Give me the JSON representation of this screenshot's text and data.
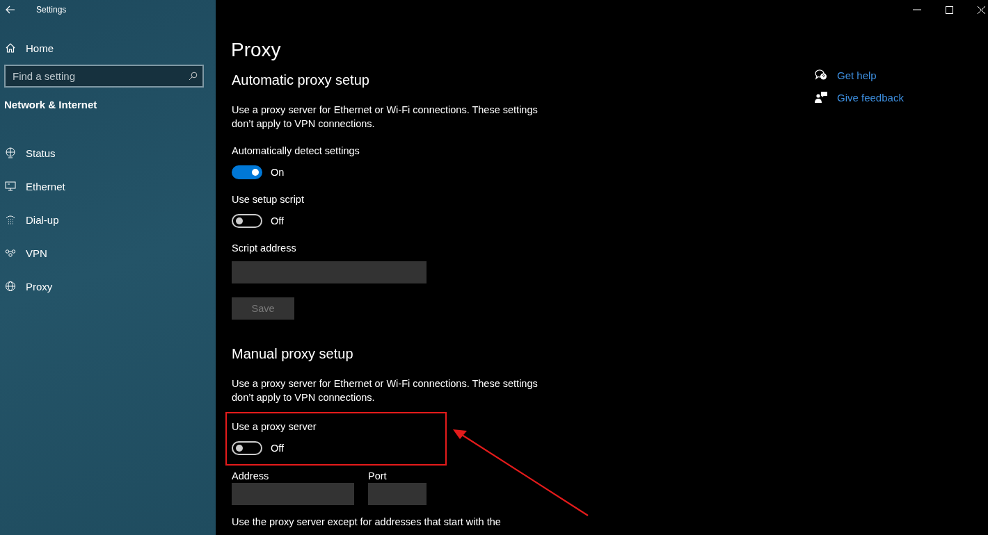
{
  "window": {
    "title": "Settings"
  },
  "sidebar": {
    "home": "Home",
    "search": {
      "placeholder": "Find a setting"
    },
    "section": "Network & Internet",
    "items": [
      {
        "label": "Status"
      },
      {
        "label": "Ethernet"
      },
      {
        "label": "Dial-up"
      },
      {
        "label": "VPN"
      },
      {
        "label": "Proxy"
      }
    ]
  },
  "page": {
    "title": "Proxy",
    "automatic": {
      "heading": "Automatic proxy setup",
      "description": "Use a proxy server for Ethernet or Wi-Fi connections. These settings don’t apply to VPN connections.",
      "toggles": [
        {
          "label": "Automatically detect settings",
          "on": true,
          "state": "On"
        },
        {
          "label": "Use setup script",
          "on": false,
          "state": "Off"
        }
      ],
      "script_address": {
        "label": "Script address"
      },
      "save": {
        "label": "Save",
        "disabled": true
      }
    },
    "manual": {
      "heading": "Manual proxy setup",
      "description": "Use a proxy server for Ethernet or Wi-Fi connections. These settings don’t apply to VPN connections.",
      "toggle": {
        "label": "Use a proxy server",
        "on": false,
        "state": "Off"
      },
      "address": {
        "label": "Address"
      },
      "port": {
        "label": "Port"
      },
      "exceptions_text": "Use the proxy server except for addresses that start with the"
    }
  },
  "help_links": [
    {
      "label": "Get help"
    },
    {
      "label": "Give feedback"
    }
  ]
}
